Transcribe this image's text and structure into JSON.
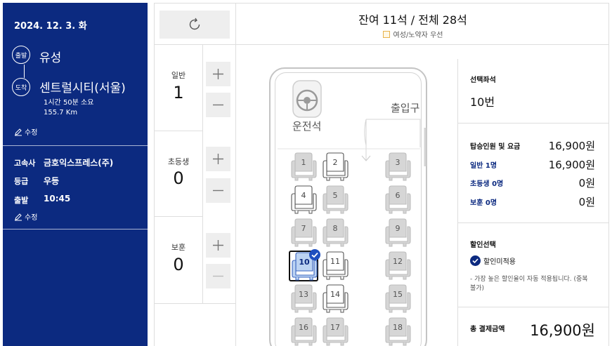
{
  "trip": {
    "date": "2024. 12. 3. 화",
    "departure_badge": "출발",
    "departure": "유성",
    "arrival_badge": "도착",
    "arrival": "센트럴시티(서울)",
    "duration": "1시간 50분 소요",
    "distance": "155.7 Km",
    "edit_label": "수정",
    "company_label": "고속사",
    "company": "금호익스프레스(주)",
    "grade_label": "등급",
    "grade": "우등",
    "depart_time_label": "출발",
    "depart_time": "10:45",
    "edit_label_2": "수정"
  },
  "passengers": [
    {
      "label": "일반",
      "count": "1"
    },
    {
      "label": "초등생",
      "count": "0"
    },
    {
      "label": "보훈",
      "count": "0"
    }
  ],
  "seatmap": {
    "availability": "잔여 11석 / 전체 28석",
    "legend": "여성/노약자 우선",
    "driver_label": "운전석",
    "entrance_label": "출입구",
    "seats": [
      {
        "n": "1",
        "status": "sold"
      },
      {
        "n": "2",
        "status": "available"
      },
      {
        "n": "3",
        "status": "sold"
      },
      {
        "n": "4",
        "status": "available"
      },
      {
        "n": "5",
        "status": "sold"
      },
      {
        "n": "6",
        "status": "sold"
      },
      {
        "n": "7",
        "status": "sold"
      },
      {
        "n": "8",
        "status": "sold"
      },
      {
        "n": "9",
        "status": "sold"
      },
      {
        "n": "10",
        "status": "selected"
      },
      {
        "n": "11",
        "status": "available"
      },
      {
        "n": "12",
        "status": "sold"
      },
      {
        "n": "13",
        "status": "sold"
      },
      {
        "n": "14",
        "status": "available"
      },
      {
        "n": "15",
        "status": "sold"
      },
      {
        "n": "16",
        "status": "sold"
      },
      {
        "n": "17",
        "status": "sold"
      },
      {
        "n": "18",
        "status": "sold"
      }
    ]
  },
  "summary": {
    "selected_seat_label": "선택좌석",
    "selected_seat": "10번",
    "fare_label": "탑승인원 및 요금",
    "fare_total": "16,900원",
    "fares": [
      {
        "label": "일반 1명",
        "amount": "16,900원"
      },
      {
        "label": "초등생 0명",
        "amount": "0원"
      },
      {
        "label": "보훈 0명",
        "amount": "0원"
      }
    ],
    "discount_label": "할인선택",
    "discount_option": "할인미적용",
    "discount_note": "- 가장 높은 할인율이 자동 적용됩니다. (중복불가)",
    "total_label": "총 결제금액",
    "total": "16,900원"
  },
  "colors": {
    "navy": "#0c2a80",
    "check_blue": "#1f4fbf",
    "sold_seat": "#d6d6d6",
    "selected_seat": "#bcd3f2",
    "priority_legend": "#e8b24a"
  }
}
